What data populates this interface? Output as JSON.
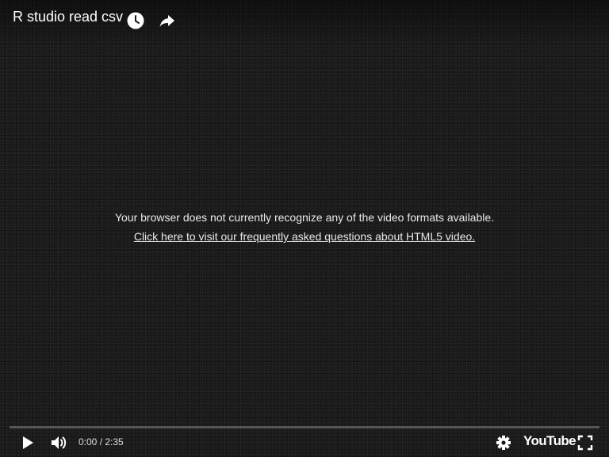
{
  "video": {
    "title": "R studio read csv"
  },
  "error": {
    "message": "Your browser does not currently recognize any of the video formats available.",
    "link_text": "Click here to visit our frequently asked questions about HTML5 video."
  },
  "controls": {
    "current_time": "0:00",
    "duration": "2:35",
    "time_text": "0:00 / 2:35",
    "progress": 0,
    "brand_label": "YouTube"
  },
  "icons": {
    "watch_later": "clock-icon",
    "share": "share-arrow-icon",
    "play": "play-icon",
    "volume": "volume-icon",
    "settings": "gear-icon",
    "fullscreen": "fullscreen-icon"
  },
  "colors": {
    "background": "#1a1a1a",
    "text": "#ffffff",
    "progress_played": "#ff0000"
  }
}
